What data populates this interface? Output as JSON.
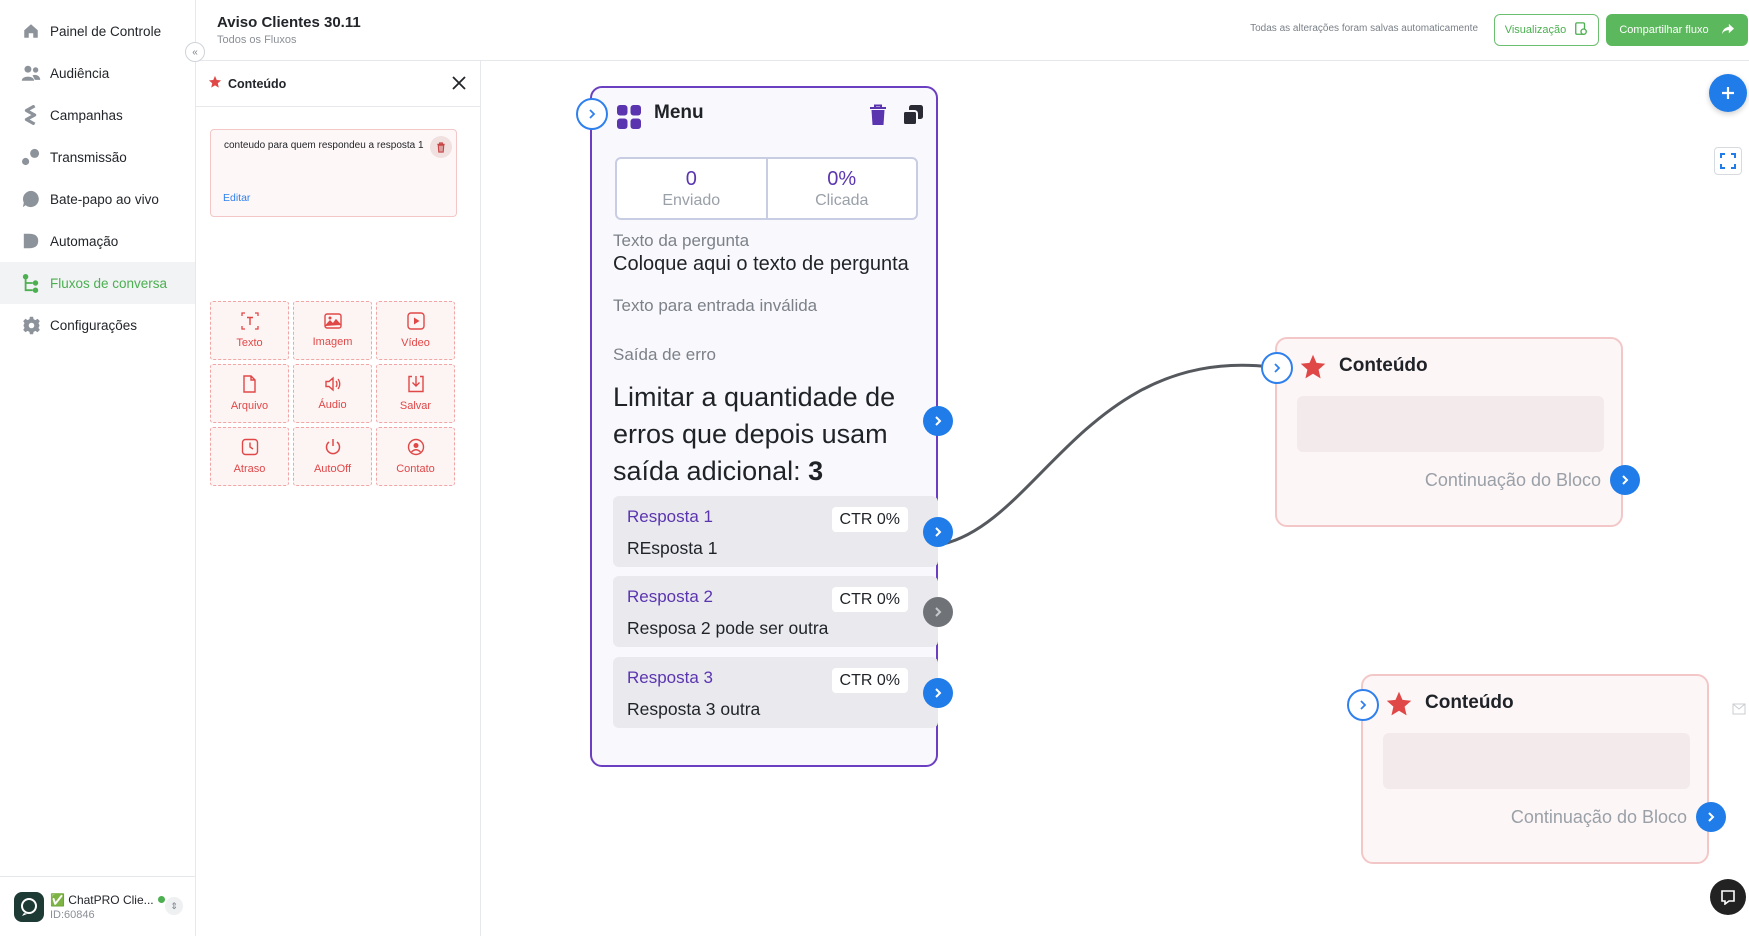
{
  "sidebar": {
    "items": [
      {
        "label": "Painel de Controle",
        "icon": "home-icon"
      },
      {
        "label": "Audiência",
        "icon": "users-icon"
      },
      {
        "label": "Campanhas",
        "icon": "campaigns-icon"
      },
      {
        "label": "Transmissão",
        "icon": "broadcast-icon"
      },
      {
        "label": "Bate-papo ao vivo",
        "icon": "chat-bubble-icon"
      },
      {
        "label": "Automação",
        "icon": "automation-icon"
      },
      {
        "label": "Fluxos de conversa",
        "icon": "flows-icon"
      },
      {
        "label": "Configurações",
        "icon": "gear-icon"
      }
    ],
    "active_index": 6,
    "account": {
      "name": "✅ ChatPRO Clie...",
      "id": "ID:60846"
    }
  },
  "header": {
    "title": "Aviso Clientes 30.11",
    "breadcrumb": "Todos os Fluxos",
    "saved_note": "Todas as alterações foram salvas automaticamente",
    "preview_label": "Visualização",
    "share_label": "Compartilhar fluxo"
  },
  "panel": {
    "title": "Conteúdo",
    "message_text": "conteudo para quem respondeu a resposta 1",
    "edit_label": "Editar",
    "tools": [
      {
        "label": "Texto",
        "icon": "text-icon"
      },
      {
        "label": "Imagem",
        "icon": "image-icon"
      },
      {
        "label": "Vídeo",
        "icon": "video-icon"
      },
      {
        "label": "Arquivo",
        "icon": "file-icon"
      },
      {
        "label": "Áudio",
        "icon": "audio-icon"
      },
      {
        "label": "Salvar",
        "icon": "save-icon"
      },
      {
        "label": "Atraso",
        "icon": "delay-icon"
      },
      {
        "label": "AutoOff",
        "icon": "power-icon"
      },
      {
        "label": "Contato",
        "icon": "contact-icon"
      }
    ]
  },
  "menu_node": {
    "title": "Menu",
    "stats": {
      "sent_value": "0",
      "sent_label": "Enviado",
      "clicked_value": "0%",
      "clicked_label": "Clicada"
    },
    "question_label": "Texto da pergunta",
    "question_value": "Coloque aqui o texto de pergunta",
    "invalid_label": "Texto para entrada inválida",
    "error_label": "Saída de erro",
    "error_text": "Limitar a quantidade de erros que depois usam saída adicional: ",
    "error_limit": "3",
    "responses": [
      {
        "title": "Resposta 1",
        "text": "REsposta 1",
        "ctr": "CTR 0%",
        "connected": true
      },
      {
        "title": "Resposta 2",
        "text": "Resposa 2 pode ser outra",
        "ctr": "CTR 0%",
        "connected": false
      },
      {
        "title": "Resposta 3",
        "text": "Resposta 3 outra",
        "ctr": "CTR 0%",
        "connected": true
      }
    ]
  },
  "content_nodes": [
    {
      "title": "Conteúdo",
      "continuation": "Continuação do Bloco"
    },
    {
      "title": "Conteúdo",
      "continuation": "Continuação do Bloco"
    }
  ],
  "colors": {
    "accent_green": "#4caf50",
    "menu_purple": "#6a3fc1",
    "port_blue": "#1f7ce8",
    "content_red": "#e04848"
  }
}
